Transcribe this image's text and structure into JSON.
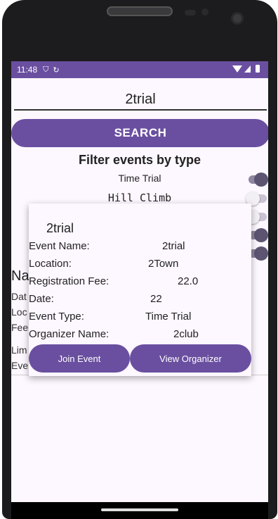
{
  "status_bar": {
    "time": "11:48",
    "icons": [
      "vpn-icon",
      "sync-icon"
    ],
    "right_icons": [
      "wifi-icon",
      "signal-icon",
      "battery-icon"
    ]
  },
  "search": {
    "value": "2trial",
    "button_label": "SEARCH"
  },
  "filter": {
    "title": "Filter events by type",
    "options": [
      {
        "label": "Time Trial",
        "enabled": true
      },
      {
        "label": "Hill Climb",
        "enabled": false
      },
      {
        "label": "",
        "enabled": false
      },
      {
        "label": "",
        "enabled": true
      },
      {
        "label": "",
        "enabled": true
      }
    ]
  },
  "background_details": {
    "heading": "Na",
    "lines": [
      "Dat",
      "Loc",
      "Fee",
      "Lim",
      "Eve"
    ]
  },
  "dialog": {
    "title": "2trial",
    "rows": [
      {
        "label": "Event Name:",
        "value": "2trial"
      },
      {
        "label": "Location:",
        "value": "2Town"
      },
      {
        "label": "Registration Fee:",
        "value": "22.0"
      },
      {
        "label": "Date:",
        "value": "22"
      },
      {
        "label": "Event Type:",
        "value": "Time Trial"
      },
      {
        "label": "Organizer Name:",
        "value": "2club"
      }
    ],
    "join_label": "Join Event",
    "view_label": "View Organizer"
  },
  "colors": {
    "accent": "#6a4fa0",
    "background": "#fdf7ff"
  }
}
